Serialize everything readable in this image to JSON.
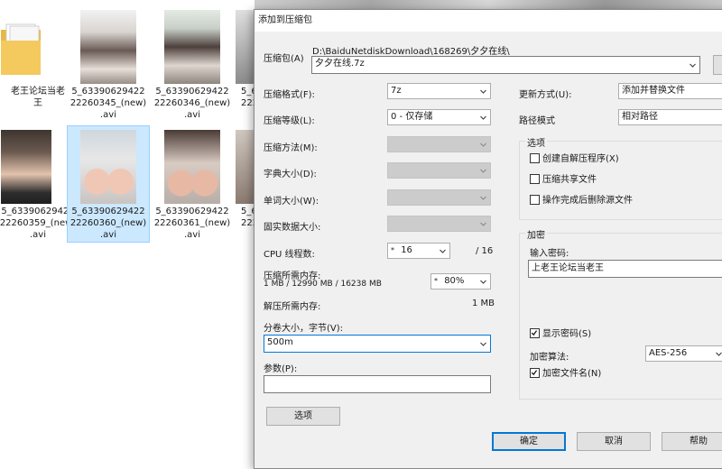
{
  "explorer": {
    "files": [
      {
        "name_line1": "老王论坛当老",
        "name_line2": "王",
        "name_line3": "",
        "kind": "folder",
        "selected": false
      },
      {
        "name_line1": "5_63390629422",
        "name_line2": "22260345_(new)",
        "name_line3": ".avi",
        "kind": "video",
        "selected": false
      },
      {
        "name_line1": "5_63390629422",
        "name_line2": "22260346_(new)",
        "name_line3": ".avi",
        "kind": "video",
        "selected": false
      },
      {
        "name_line1": "5_6",
        "name_line2": "222",
        "name_line3": "",
        "kind": "video",
        "selected": false
      },
      {
        "name_line1": "5_63390629422",
        "name_line2": "22260359_(new)",
        "name_line3": ".avi",
        "kind": "video",
        "selected": false
      },
      {
        "name_line1": "5_63390629422",
        "name_line2": "22260360_(new)",
        "name_line3": ".avi",
        "kind": "video",
        "selected": true
      },
      {
        "name_line1": "5_63390629422",
        "name_line2": "22260361_(new)",
        "name_line3": ".avi",
        "kind": "video",
        "selected": false
      },
      {
        "name_line1": "5_6",
        "name_line2": "222",
        "name_line3": "",
        "kind": "video",
        "selected": false
      }
    ]
  },
  "dialog": {
    "title": "添加到压缩包",
    "archive": {
      "label": "压缩包(A)",
      "path": "D:\\BaiduNetdiskDownload\\168269\\夕夕在线\\",
      "filename": "夕夕在线.7z"
    },
    "left": {
      "format_label": "压缩格式(F):",
      "format_value": "7z",
      "level_label": "压缩等级(L):",
      "level_value": "0 - 仅存储",
      "method_label": "压缩方法(M):",
      "dict_label": "字典大小(D):",
      "word_label": "单词大小(W):",
      "solid_label": "固实数据大小:",
      "cpu_label": "CPU 线程数:",
      "cpu_value": "16",
      "cpu_total": "/ 16",
      "mem_label": "压缩所需内存:",
      "mem_detail": "1 MB / 12990 MB / 16238 MB",
      "mem_percent": "80%",
      "decomp_label": "解压所需内存:",
      "decomp_value": "1 MB",
      "volume_label": "分卷大小，字节(V):",
      "volume_value": "500m",
      "params_label": "参数(P):",
      "params_value": "",
      "options_button": "选项"
    },
    "right": {
      "update_label": "更新方式(U):",
      "update_value": "添加并替换文件",
      "path_label": "路径模式",
      "path_value": "相对路径",
      "options_group": "选项",
      "sfx": "创建自解压程序(X)",
      "shared": "压缩共享文件",
      "delete_after": "操作完成后删除源文件",
      "encryption_group": "加密",
      "password_label": "输入密码:",
      "password_value": "上老王论坛当老王",
      "show_password": "显示密码(S)",
      "enc_method_label": "加密算法:",
      "enc_method_value": "AES-256",
      "encrypt_names": "加密文件名(N)"
    },
    "buttons": {
      "ok": "确定",
      "cancel": "取消",
      "help": "帮助"
    },
    "checks": {
      "sfx": false,
      "shared": false,
      "delete_after": false,
      "show_password": true,
      "encrypt_names": true
    }
  }
}
